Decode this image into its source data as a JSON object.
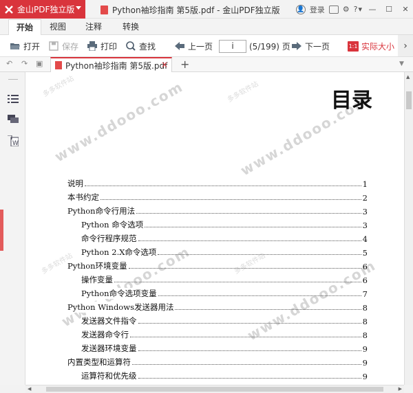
{
  "titlebar": {
    "app_menu_label": "金山PDF独立版",
    "document_title": "Python袖珍指南 第5版.pdf - 金山PDF独立版",
    "login_label": "登录",
    "help_label": "?"
  },
  "menu": {
    "tabs": [
      {
        "label": "开始"
      },
      {
        "label": "视图"
      },
      {
        "label": "注释"
      },
      {
        "label": "转换"
      }
    ]
  },
  "toolbar": {
    "open": "打开",
    "save": "保存",
    "print": "打印",
    "find": "查找",
    "prev_page": "上一页",
    "page_value": "i",
    "page_count": "(5/199) 页",
    "next_page": "下一页",
    "actual_size_icon_text": "1:1",
    "actual_size": "实际大小"
  },
  "tabs": {
    "file_tab": "Python袖珍指南 第5版.pdf",
    "close": "×",
    "add": "+"
  },
  "document": {
    "heading": "目录",
    "watermark": "www.ddooo.com",
    "watermark_small": "多多软件站",
    "toc": [
      {
        "title": "说明",
        "page": "1",
        "level": 1
      },
      {
        "title": "本书约定",
        "page": "2",
        "level": 1
      },
      {
        "title": "Python命令行用法",
        "page": "3",
        "level": 1
      },
      {
        "title": "Python 命令选项",
        "page": "3",
        "level": 2
      },
      {
        "title": "命令行程序规范",
        "page": "4",
        "level": 2
      },
      {
        "title": "Python 2.X命令选项",
        "page": "5",
        "level": 2
      },
      {
        "title": "Python环境变量",
        "page": "6",
        "level": 1
      },
      {
        "title": "操作变量",
        "page": "6",
        "level": 2
      },
      {
        "title": "Python命令选项变量",
        "page": "7",
        "level": 2
      },
      {
        "title": "Python Windows发送器用法",
        "page": "8",
        "level": 1
      },
      {
        "title": "发送器文件指令",
        "page": "8",
        "level": 2
      },
      {
        "title": "发送器命令行",
        "page": "8",
        "level": 2
      },
      {
        "title": "发送器环境变量",
        "page": "9",
        "level": 2
      },
      {
        "title": "内置类型和运算符",
        "page": "9",
        "level": 1
      },
      {
        "title": "运算符和优先级",
        "page": "9",
        "level": 2
      }
    ]
  },
  "colors": {
    "brand": "#d9343c",
    "sidebar_handle": "#e35b5b"
  }
}
